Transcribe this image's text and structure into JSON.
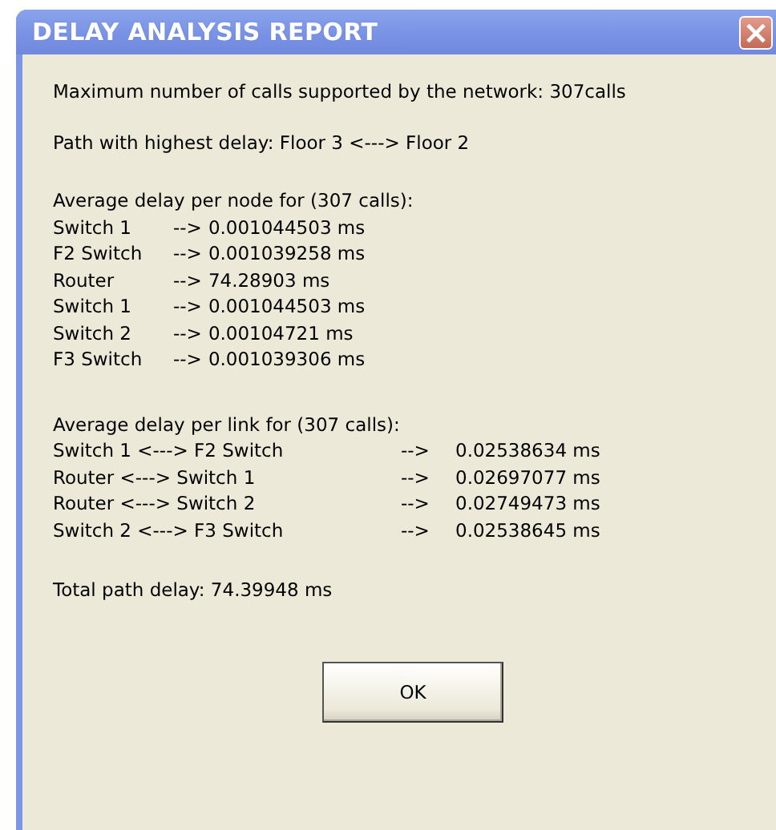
{
  "window": {
    "title": "DELAY ANALYSIS REPORT",
    "close_button": "×"
  },
  "summary": {
    "max_calls": "Maximum number of calls supported by the network: 307calls",
    "highest_delay_path": "Path with highest delay: Floor 3 <---> Floor 2"
  },
  "node_delays": {
    "heading": "Average delay per node for (307 calls):",
    "rows": [
      {
        "name": "Switch 1",
        "arrow": "-->",
        "value": "0.001044503 ms"
      },
      {
        "name": "F2 Switch",
        "arrow": "-->",
        "value": "0.001039258 ms"
      },
      {
        "name": "Router",
        "arrow": "-->",
        "value": "74.28903 ms"
      },
      {
        "name": "Switch 1",
        "arrow": "-->",
        "value": "0.001044503 ms"
      },
      {
        "name": "Switch 2",
        "arrow": "-->",
        "value": "0.00104721 ms"
      },
      {
        "name": "F3 Switch",
        "arrow": "-->",
        "value": "0.001039306 ms"
      }
    ]
  },
  "link_delays": {
    "heading": "Average delay per link for (307 calls):",
    "rows": [
      {
        "name": "Switch 1 <---> F2 Switch",
        "arrow": "-->",
        "value": "0.02538634 ms"
      },
      {
        "name": "Router <---> Switch 1",
        "arrow": "-->",
        "value": "0.02697077 ms"
      },
      {
        "name": "Router <---> Switch 2",
        "arrow": "-->",
        "value": "0.02749473 ms"
      },
      {
        "name": "Switch 2 <---> F3 Switch",
        "arrow": "-->",
        "value": "0.02538645 ms"
      }
    ]
  },
  "total": "Total path delay: 74.39948 ms",
  "buttons": [
    "OK"
  ]
}
